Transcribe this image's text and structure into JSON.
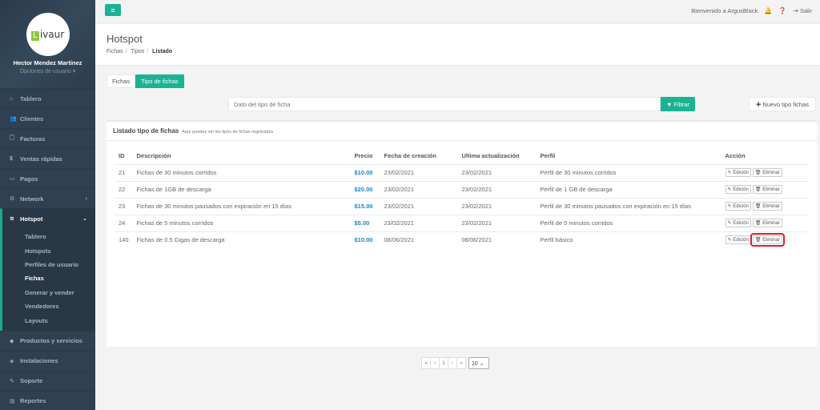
{
  "sidebar": {
    "logo_text": "ivaur",
    "logo_letter": "L",
    "user_name": "Hector Mendez Martinez",
    "user_options": "Opciones de usuario ▾",
    "items_top": [
      {
        "label": "Tablero",
        "icon": "dashboard-icon",
        "glyph": "⌂"
      },
      {
        "label": "Clientes",
        "icon": "users-icon",
        "glyph": "👥"
      },
      {
        "label": "Facturas",
        "icon": "document-icon",
        "glyph": "🗋"
      },
      {
        "label": "Ventas rápidas",
        "icon": "dollar-icon",
        "glyph": "$"
      },
      {
        "label": "Pagos",
        "icon": "money-icon",
        "glyph": "▭"
      },
      {
        "label": "Network",
        "icon": "network-icon",
        "glyph": "⚙",
        "chevron": "‹"
      }
    ],
    "active": {
      "label": "Hotspot",
      "icon": "wifi-icon",
      "glyph": "≋",
      "chevron": "⌄"
    },
    "sub_items": [
      "Tablero",
      "Hotspots",
      "Perfiles de usuario",
      "Fichas",
      "Generar y vender",
      "Vendedores",
      "Layouts"
    ],
    "current_sub": "Fichas",
    "items_bottom": [
      {
        "label": "Productos y servicios",
        "icon": "tag-icon",
        "glyph": "◆"
      },
      {
        "label": "Instalaciones",
        "icon": "diamond-icon",
        "glyph": "◈"
      },
      {
        "label": "Soporte",
        "icon": "wrench-icon",
        "glyph": "✎"
      },
      {
        "label": "Reportes",
        "icon": "report-icon",
        "glyph": "▤"
      }
    ]
  },
  "topbar": {
    "menu_glyph": "≡",
    "welcome": "Bienvenido a ArgusBlack",
    "logout": "Salir"
  },
  "heading": {
    "title": "Hotspot",
    "crumbs": [
      "Fichas",
      "Tipos",
      "Listado"
    ]
  },
  "tabs": [
    "Fichas",
    "Tipo de fichas"
  ],
  "filter": {
    "placeholder": "Dato del tipo de ficha",
    "button": "Filtrar",
    "new_button": "Nuevo tipo fichas"
  },
  "panel": {
    "title": "Listado tipo de fichas",
    "subtitle": "Aquí puedes ver los tipos de fichas registrados"
  },
  "table": {
    "headers": [
      "ID",
      "Descripción",
      "Precio",
      "Fecha de creación",
      "Ultima actualización",
      "Perfil",
      "Acción"
    ],
    "rows": [
      {
        "id": "21",
        "desc": "Fichas de 30 minutos corridos",
        "price": "$10.00",
        "created": "23/02/2021",
        "updated": "23/02/2021",
        "profile": "Perfil de 30 minutos corridos"
      },
      {
        "id": "22",
        "desc": "Fichas de 1GB de descarga",
        "price": "$20.00",
        "created": "23/02/2021",
        "updated": "23/02/2021",
        "profile": "Perfil de 1 GB de descarga"
      },
      {
        "id": "23",
        "desc": "Fichas de 30 minutos pausados con expiración en 15 días",
        "price": "$15.00",
        "created": "23/02/2021",
        "updated": "23/02/2021",
        "profile": "Perfil de 30 minutos pausados con expiración en 15 días"
      },
      {
        "id": "24",
        "desc": "Fichas de 5 minutos corridos",
        "price": "$5.00",
        "created": "23/02/2021",
        "updated": "23/02/2021",
        "profile": "Perfil de 5 minutos corridos"
      },
      {
        "id": "140",
        "desc": "Fichas de 0.5 Gigas de descarga",
        "price": "$10.00",
        "created": "08/06/2021",
        "updated": "08/06/2021",
        "profile": "Perfil básico"
      }
    ],
    "edit_label": "Edición",
    "delete_label": "Eliminar"
  },
  "pagination": {
    "buttons": [
      "«",
      "‹",
      "1",
      "›",
      "»"
    ],
    "page_size": "10"
  }
}
